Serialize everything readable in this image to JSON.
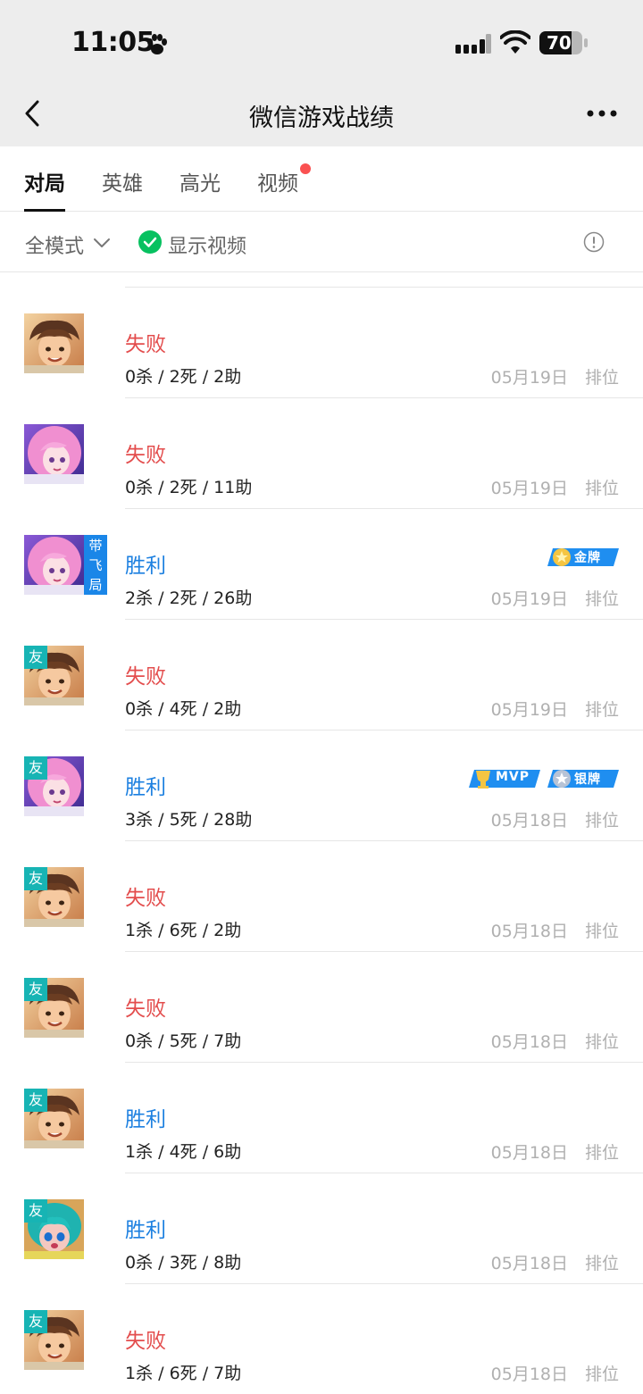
{
  "status_bar": {
    "time": "11:05",
    "battery": "70"
  },
  "nav": {
    "title": "微信游戏战绩"
  },
  "tabs": [
    {
      "label": "对局",
      "active": true
    },
    {
      "label": "英雄",
      "active": false
    },
    {
      "label": "高光",
      "active": false
    },
    {
      "label": "视频",
      "active": false,
      "has_dot": true
    }
  ],
  "filters": {
    "mode": "全模式",
    "show_video": "显示视频"
  },
  "matches": [
    {
      "result": "失败",
      "outcome": "lose",
      "stats": "0杀 / 2死 / 2助",
      "date": "05月19日",
      "mode": "排位",
      "hero": "brown-hair-hero",
      "tag": ""
    },
    {
      "result": "失败",
      "outcome": "lose",
      "stats": "0杀 / 2死 / 11助",
      "date": "05月19日",
      "mode": "排位",
      "hero": "pink-hair-hero",
      "tag": ""
    },
    {
      "result": "胜利",
      "outcome": "win",
      "stats": "2杀 / 2死 / 26助",
      "date": "05月19日",
      "mode": "排位",
      "hero": "pink-hair-hero",
      "tag": "带飞局",
      "badges": [
        "金牌"
      ]
    },
    {
      "result": "失败",
      "outcome": "lose",
      "stats": "0杀 / 4死 / 2助",
      "date": "05月19日",
      "mode": "排位",
      "hero": "brown-hair-hero",
      "tag": "友"
    },
    {
      "result": "胜利",
      "outcome": "win",
      "stats": "3杀 / 5死 / 28助",
      "date": "05月18日",
      "mode": "排位",
      "hero": "pink-hair-hero",
      "tag": "友",
      "badges": [
        "MVP",
        "银牌"
      ]
    },
    {
      "result": "失败",
      "outcome": "lose",
      "stats": "1杀 / 6死 / 2助",
      "date": "05月18日",
      "mode": "排位",
      "hero": "brown-hair-hero",
      "tag": "友"
    },
    {
      "result": "失败",
      "outcome": "lose",
      "stats": "0杀 / 5死 / 7助",
      "date": "05月18日",
      "mode": "排位",
      "hero": "brown-hair-hero",
      "tag": "友"
    },
    {
      "result": "胜利",
      "outcome": "win",
      "stats": "1杀 / 4死 / 6助",
      "date": "05月18日",
      "mode": "排位",
      "hero": "brown-hair-hero",
      "tag": "友"
    },
    {
      "result": "胜利",
      "outcome": "win",
      "stats": "0杀 / 3死 / 8助",
      "date": "05月18日",
      "mode": "排位",
      "hero": "teal-hair-hero",
      "tag": "友"
    },
    {
      "result": "失败",
      "outcome": "lose",
      "stats": "1杀 / 6死 / 7助",
      "date": "05月18日",
      "mode": "排位",
      "hero": "brown-hair-hero",
      "tag": "友"
    }
  ],
  "colors": {
    "lose": "#e34d4d",
    "win": "#1d80e0",
    "friend_tag": "#17b4b4",
    "carry_tag": "#1a86e8",
    "check": "#07c160"
  }
}
